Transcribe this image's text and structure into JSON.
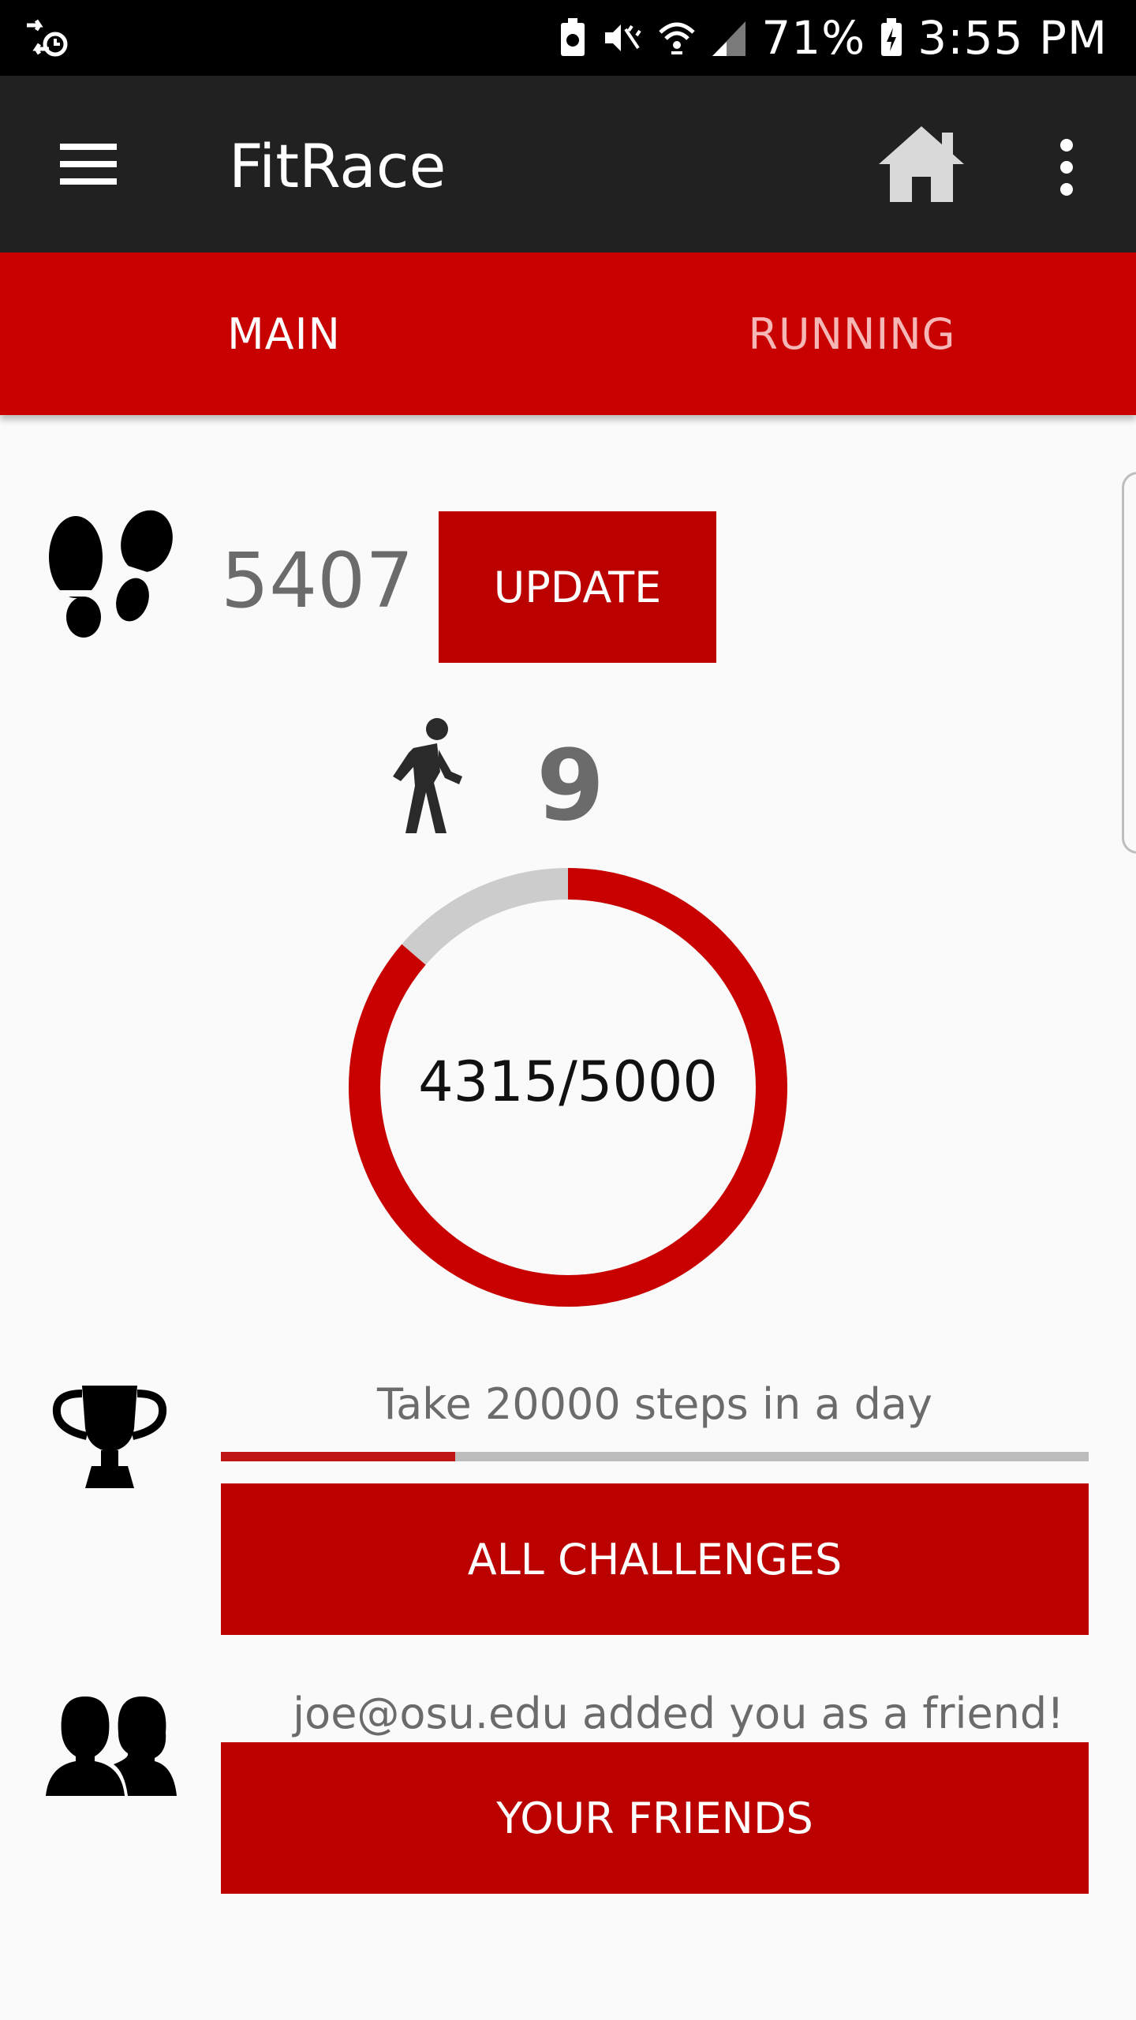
{
  "status_bar": {
    "battery": "71%",
    "time": "3:55 PM"
  },
  "app_bar": {
    "title": "FitRace"
  },
  "tabs": [
    {
      "label": "MAIN",
      "selected": true
    },
    {
      "label": "RUNNING",
      "selected": false
    }
  ],
  "steps": {
    "value": "5407",
    "update_label": "UPDATE"
  },
  "level": {
    "value": "9"
  },
  "goal": {
    "current": 4315,
    "target": 5000,
    "text": "4315/5000"
  },
  "challenge": {
    "text": "Take 20000 steps in a day",
    "progress": 0.27,
    "button_label": "ALL CHALLENGES"
  },
  "friends": {
    "notification": "joe@osu.edu added you as a friend!",
    "button_label": "YOUR FRIENDS"
  },
  "colors": {
    "accent": "#c80000",
    "button": "#bb0000",
    "app_bar": "#212121",
    "ring_track": "#cccccc"
  }
}
